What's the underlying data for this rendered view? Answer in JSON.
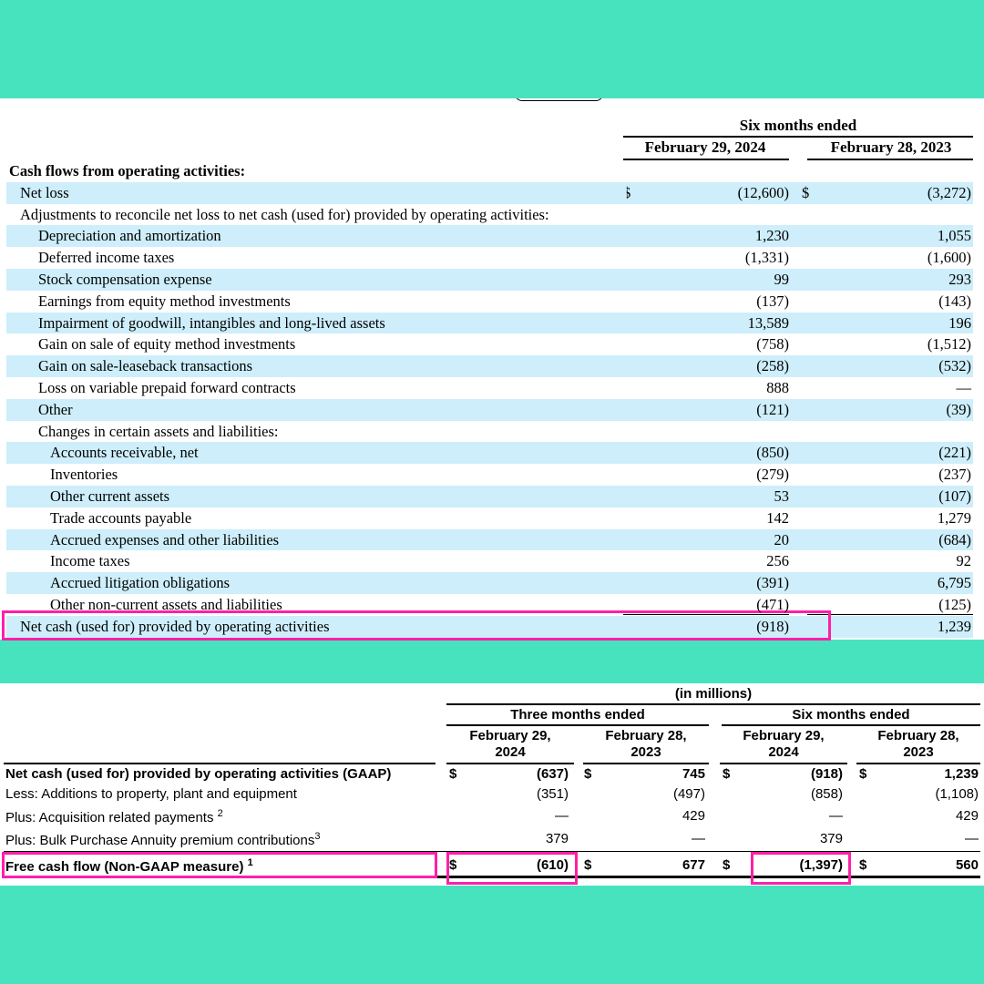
{
  "statement": {
    "period_header": "Six months ended",
    "col1_header": "February 29, 2024",
    "col2_header": "February 28, 2023",
    "dollar_sign": "$",
    "section_title": "Cash flows from operating activities:",
    "rows": [
      {
        "label": "Net loss",
        "v1": "(12,600)",
        "v2": "(3,272)",
        "level": 1,
        "band": true,
        "dollars": true
      },
      {
        "label": "Adjustments to reconcile net loss to net cash (used for) provided by operating activities:",
        "v1": "",
        "v2": "",
        "level": 1,
        "band": false
      },
      {
        "label": "Depreciation and amortization",
        "v1": "1,230",
        "v2": "1,055",
        "level": 2,
        "band": true
      },
      {
        "label": "Deferred income taxes",
        "v1": "(1,331)",
        "v2": "(1,600)",
        "level": 2,
        "band": false
      },
      {
        "label": "Stock compensation expense",
        "v1": "99",
        "v2": "293",
        "level": 2,
        "band": true
      },
      {
        "label": "Earnings from equity method investments",
        "v1": "(137)",
        "v2": "(143)",
        "level": 2,
        "band": false
      },
      {
        "label": "Impairment of goodwill, intangibles and long-lived assets",
        "v1": "13,589",
        "v2": "196",
        "level": 2,
        "band": true
      },
      {
        "label": "Gain on sale of equity method investments",
        "v1": "(758)",
        "v2": "(1,512)",
        "level": 2,
        "band": false
      },
      {
        "label": "Gain on sale-leaseback transactions",
        "v1": "(258)",
        "v2": "(532)",
        "level": 2,
        "band": true
      },
      {
        "label": "Loss on variable prepaid forward contracts",
        "v1": "888",
        "v2": "—",
        "level": 2,
        "band": false
      },
      {
        "label": "Other",
        "v1": "(121)",
        "v2": "(39)",
        "level": 2,
        "band": true
      },
      {
        "label": "Changes in certain assets and liabilities:",
        "v1": "",
        "v2": "",
        "level": 2,
        "band": false
      },
      {
        "label": "Accounts receivable, net",
        "v1": "(850)",
        "v2": "(221)",
        "level": 3,
        "band": true
      },
      {
        "label": "Inventories",
        "v1": "(279)",
        "v2": "(237)",
        "level": 3,
        "band": false
      },
      {
        "label": "Other current assets",
        "v1": "53",
        "v2": "(107)",
        "level": 3,
        "band": true
      },
      {
        "label": "Trade accounts payable",
        "v1": "142",
        "v2": "1,279",
        "level": 3,
        "band": false
      },
      {
        "label": "Accrued expenses and other liabilities",
        "v1": "20",
        "v2": "(684)",
        "level": 3,
        "band": true
      },
      {
        "label": "Income taxes",
        "v1": "256",
        "v2": "92",
        "level": 3,
        "band": false
      },
      {
        "label": "Accrued litigation obligations",
        "v1": "(391)",
        "v2": "6,795",
        "level": 3,
        "band": true
      },
      {
        "label": "Other non-current assets and liabilities",
        "v1": "(471)",
        "v2": "(125)",
        "level": 3,
        "band": false
      },
      {
        "label": "Net cash (used for) provided by operating activities",
        "v1": "(918)",
        "v2": "1,239",
        "level": 1,
        "band": true
      }
    ]
  },
  "fcf_table": {
    "units": "(in millions)",
    "group1": "Three months ended",
    "group2": "Six months ended",
    "col_headers": [
      {
        "line1": "February 29,",
        "line2": "2024"
      },
      {
        "line1": "February 28,",
        "line2": "2023"
      },
      {
        "line1": "February 29,",
        "line2": "2024"
      },
      {
        "line1": "February 28,",
        "line2": "2023"
      }
    ],
    "dollar_sign": "$",
    "rows": [
      {
        "label": "Net cash (used for) provided by operating activities (GAAP)",
        "sup": "",
        "values": [
          "(637)",
          "745",
          "(918)",
          "1,239"
        ],
        "bold": true,
        "dollars": true
      },
      {
        "label": "Less: Additions to property, plant and equipment",
        "sup": "",
        "values": [
          "(351)",
          "(497)",
          "(858)",
          "(1,108)"
        ],
        "bold": false,
        "dollars": false
      },
      {
        "label": "Plus: Acquisition related payments ",
        "sup": "2",
        "values": [
          "—",
          "429",
          "—",
          "429"
        ],
        "bold": false,
        "dollars": false
      },
      {
        "label": "Plus: Bulk Purchase Annuity premium contributions",
        "sup": "3",
        "values": [
          "379",
          "—",
          "379",
          "—"
        ],
        "bold": false,
        "dollars": false
      },
      {
        "label": "Free cash flow (Non-GAAP measure) ",
        "sup": "1",
        "values": [
          "(610)",
          "677",
          "(1,397)",
          "560"
        ],
        "bold": true,
        "dollars": true
      }
    ]
  }
}
